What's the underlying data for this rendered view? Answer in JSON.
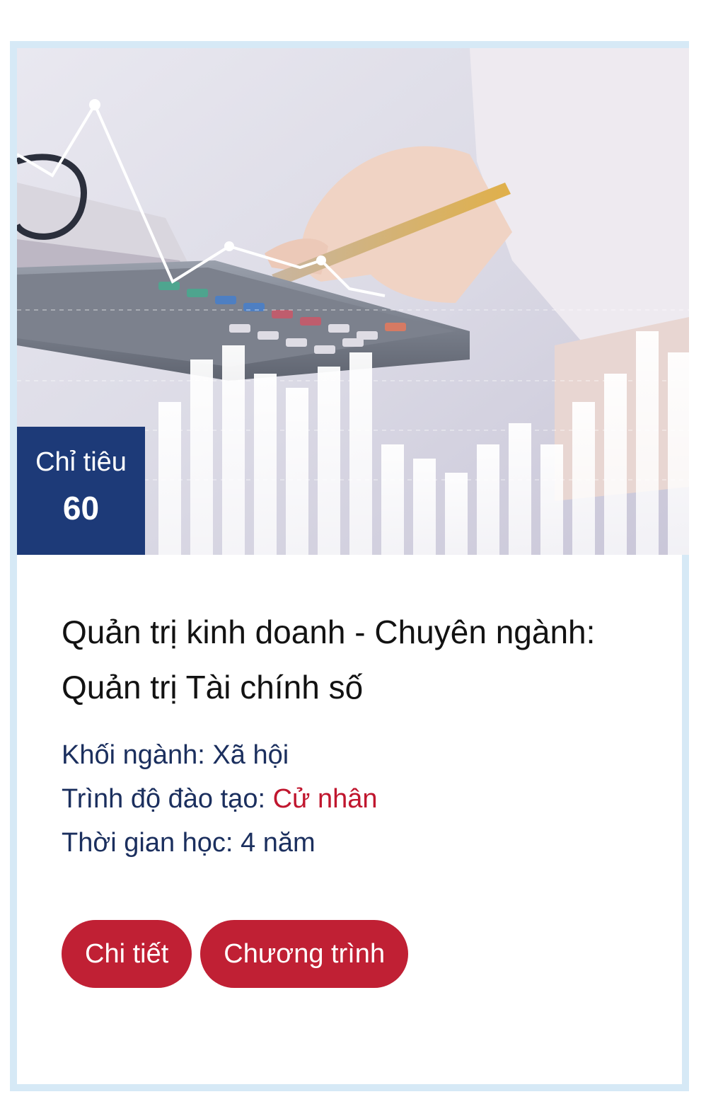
{
  "card": {
    "image_description_icon": "finance-calculator-chart-photo",
    "badge": {
      "label": "Chỉ tiêu",
      "value": "60"
    },
    "title": "Quản trị kinh doanh - Chuyên ngành: Quản trị Tài chính số",
    "details": {
      "block_label": "Khối ngành:",
      "block_value": "Xã hội",
      "level_label": "Trình độ đào tạo:",
      "level_value": "Cử nhân",
      "duration_label": "Thời gian học:",
      "duration_value": "4 năm"
    },
    "buttons": {
      "detail": "Chi tiết",
      "program": "Chương trình"
    },
    "colors": {
      "badge": "#1d3a78",
      "button": "#c02034",
      "accent_red": "#c0162e",
      "border": "#d6e9f6"
    }
  }
}
